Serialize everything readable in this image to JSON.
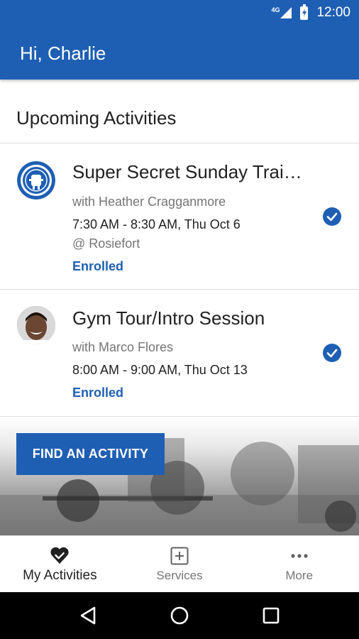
{
  "status_bar": {
    "network": "4G",
    "time": "12:00"
  },
  "header": {
    "greeting": "Hi, Charlie"
  },
  "section": {
    "title": "Upcoming Activities"
  },
  "activities": [
    {
      "title": "Super Secret Sunday Trai…",
      "instructor": "with Heather Cragganmore",
      "time": "7:30 AM - 8:30 AM, Thu Oct 6",
      "location": "@ Rosiefort",
      "status": "Enrolled"
    },
    {
      "title": "Gym Tour/Intro Session",
      "instructor": "with Marco Flores",
      "time": "8:00 AM - 9:00 AM, Thu Oct 13",
      "status": "Enrolled"
    }
  ],
  "cta": {
    "label": "FIND AN ACTIVITY"
  },
  "tabs": [
    {
      "label": "My Activities",
      "icon": "heart-check-icon",
      "active": true
    },
    {
      "label": "Services",
      "icon": "plus-square-icon",
      "active": false
    },
    {
      "label": "More",
      "icon": "more-dots-icon",
      "active": false
    }
  ],
  "colors": {
    "primary": "#1e5fb4",
    "text": "#212121",
    "secondary_text": "#757575"
  }
}
